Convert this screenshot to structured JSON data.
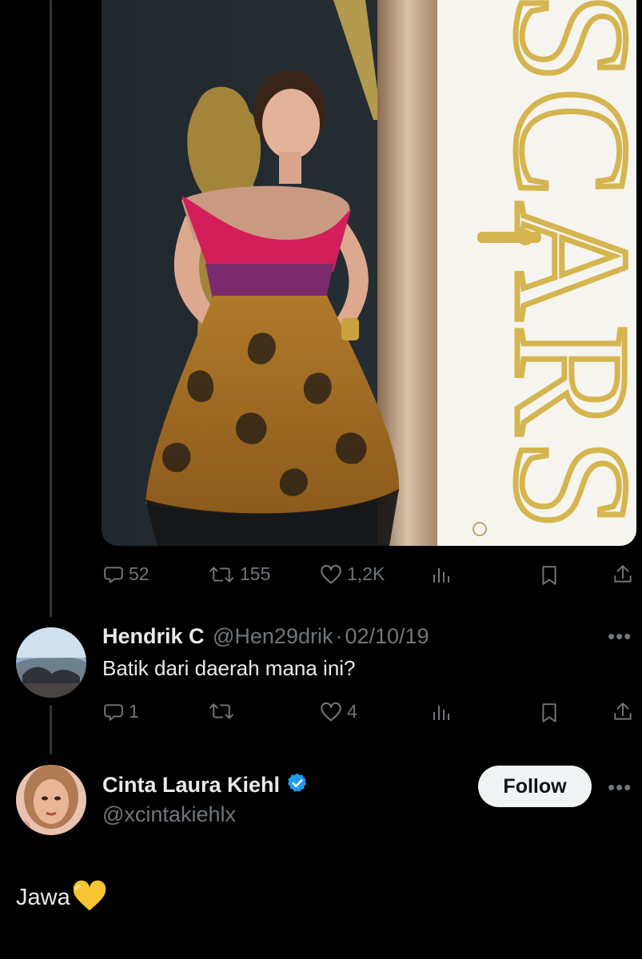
{
  "tweet": {
    "stats": {
      "replies": "52",
      "retweets": "155",
      "likes": "1,2K"
    }
  },
  "reply": {
    "name": "Hendrik C",
    "handle": "@Hen29drik",
    "separator": "·",
    "date": "02/10/19",
    "text": "Batik dari daerah mana ini?",
    "stats": {
      "replies": "1",
      "likes": "4"
    }
  },
  "author": {
    "name": "Cinta Laura Kiehl",
    "handle": "@xcintakiehlx",
    "follow_label": "Follow",
    "text": "Jawa",
    "emoji": "💛",
    "verified_color": "#1d9bf0"
  },
  "icons": {
    "reply": "comment-icon",
    "retweet": "retweet-icon",
    "like": "heart-icon",
    "views": "views-icon",
    "bookmark": "bookmark-icon",
    "share": "share-icon",
    "more": "more-icon",
    "verified": "verified-badge-icon"
  },
  "colors": {
    "background": "#000000",
    "muted": "#71767b",
    "text": "#e7e9ea",
    "button_bg": "#eff3f4",
    "heart_emoji": "#f7c531"
  }
}
